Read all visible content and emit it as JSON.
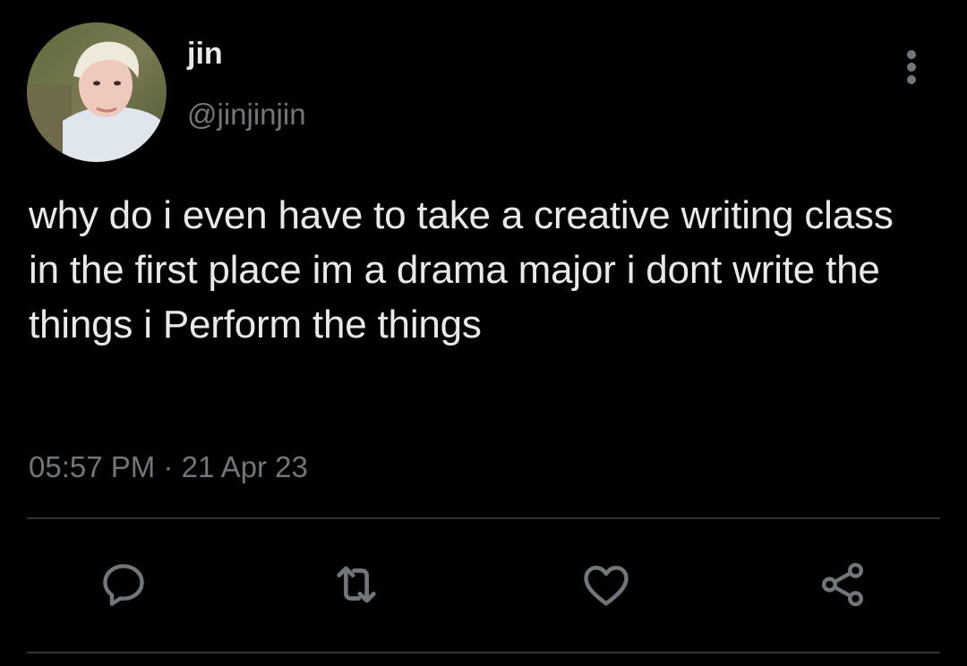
{
  "author": {
    "display_name": "jin",
    "handle": "@jinjinjin"
  },
  "tweet": {
    "text": "why do i even have to take a creative writing class in the first place im a drama major i dont write the things i Perform the things"
  },
  "meta": {
    "time": "05:57 PM",
    "separator": "·",
    "date": "21 Apr 23"
  },
  "actions": [
    "reply-icon",
    "retweet-icon",
    "like-icon",
    "share-icon"
  ],
  "colors": {
    "background": "#000000",
    "text_primary": "#e7e9ea",
    "text_secondary": "#71767b",
    "divider": "#2f3336"
  }
}
